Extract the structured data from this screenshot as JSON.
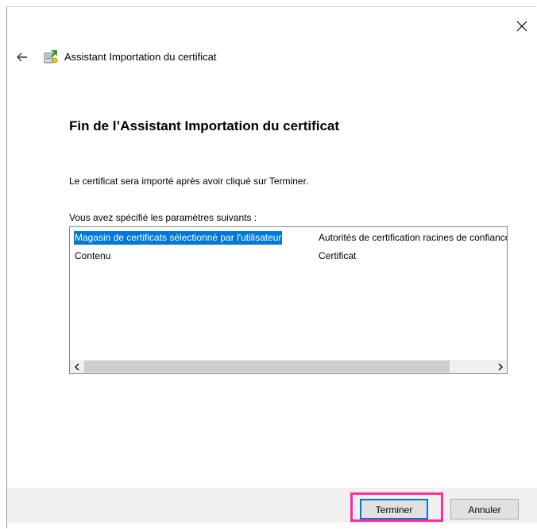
{
  "window": {
    "title": "Assistant Importation du certificat",
    "close_icon": "close-icon",
    "back_icon": "back-arrow-icon",
    "wizard_icon": "certificate-wizard-icon"
  },
  "page": {
    "heading": "Fin de l’Assistant Importation du certificat",
    "info": "Le certificat sera importé après avoir cliqué sur Terminer.",
    "settings_label": "Vous avez spécifié les paramètres suivants :"
  },
  "settings_list": {
    "rows": [
      {
        "name": "Magasin de certificats sélectionné par l'utilisateur",
        "value": "Autorités de certification racines de confiance",
        "selected": true
      },
      {
        "name": "Contenu",
        "value": "Certificat",
        "selected": false
      }
    ],
    "scroll_left_icon": "chevron-left-icon",
    "scroll_right_icon": "chevron-right-icon"
  },
  "buttons": {
    "finish": "Terminer",
    "cancel": "Annuler"
  },
  "colors": {
    "selection": "#0078d7",
    "highlight_box": "#ff2d9b",
    "footer": "#f0f0f0"
  }
}
